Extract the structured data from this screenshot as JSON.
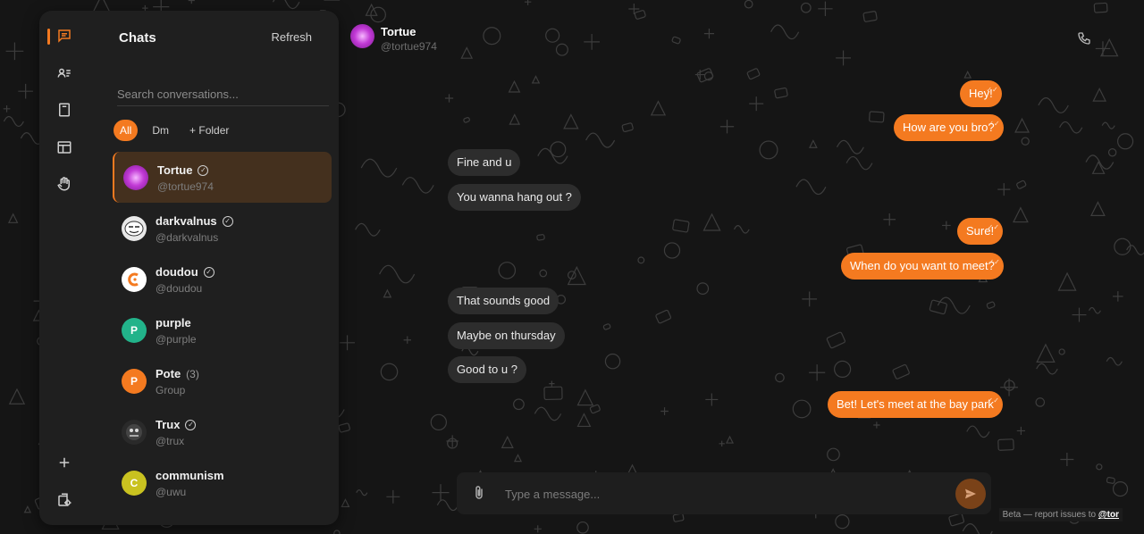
{
  "sidebar": {
    "title": "Chats",
    "refresh_label": "Refresh",
    "search_placeholder": "Search conversations...",
    "filters": [
      {
        "label": "All",
        "active": true
      },
      {
        "label": "Dm",
        "active": false
      },
      {
        "label": "+ Folder",
        "active": false
      }
    ],
    "rail_icons": [
      "chat-icon",
      "contacts-icon",
      "notes-icon",
      "layout-icon",
      "hand-icon",
      "plus-icon",
      "settings-icon"
    ]
  },
  "contacts": [
    {
      "name": "Tortue",
      "sub": "@tortue974",
      "verified": true,
      "avatar_letter": "",
      "avatar_color": "#c23ad6",
      "selected": true
    },
    {
      "name": "darkvalnus",
      "sub": "@darkvalnus",
      "verified": true,
      "avatar_letter": "",
      "avatar_color": "#e8e8e8",
      "selected": false
    },
    {
      "name": "doudou",
      "sub": "@doudou",
      "verified": true,
      "avatar_letter": "",
      "avatar_color": "#ffffff",
      "selected": false
    },
    {
      "name": "purple",
      "sub": "@purple",
      "verified": false,
      "avatar_letter": "P",
      "avatar_color": "#22b38a",
      "selected": false
    },
    {
      "name": "Pote",
      "count": "(3)",
      "sub": "Group",
      "verified": false,
      "avatar_letter": "P",
      "avatar_color": "#f47a20",
      "selected": false
    },
    {
      "name": "Trux",
      "sub": "@trux",
      "verified": true,
      "avatar_letter": "",
      "avatar_color": "#333333",
      "selected": false
    },
    {
      "name": "communism",
      "sub": "@uwu",
      "verified": false,
      "avatar_letter": "C",
      "avatar_color": "#c9c220",
      "selected": false
    }
  ],
  "chat": {
    "name": "Tortue",
    "handle": "@tortue974"
  },
  "messages": [
    {
      "text": "Hey!",
      "dir": "out"
    },
    {
      "text": "How are you bro?",
      "dir": "out"
    },
    {
      "text": "Fine and u",
      "dir": "in"
    },
    {
      "text": "You wanna hang out ?",
      "dir": "in"
    },
    {
      "text": "Sure!",
      "dir": "out"
    },
    {
      "text": "When do you want to meet?",
      "dir": "out"
    },
    {
      "text": "That sounds good",
      "dir": "in"
    },
    {
      "text": "Maybe on thursday",
      "dir": "in"
    },
    {
      "text": "Good to u ?",
      "dir": "in"
    },
    {
      "text": "Bet! Let's meet at the bay park",
      "dir": "out"
    }
  ],
  "composer": {
    "placeholder": "Type a message..."
  },
  "footer": {
    "beta_text": "Beta — report issues to ",
    "beta_handle": "@tor"
  },
  "colors": {
    "accent": "#f47a20",
    "panel": "#1f1f1f",
    "incoming_bubble": "#2d2d2d"
  }
}
